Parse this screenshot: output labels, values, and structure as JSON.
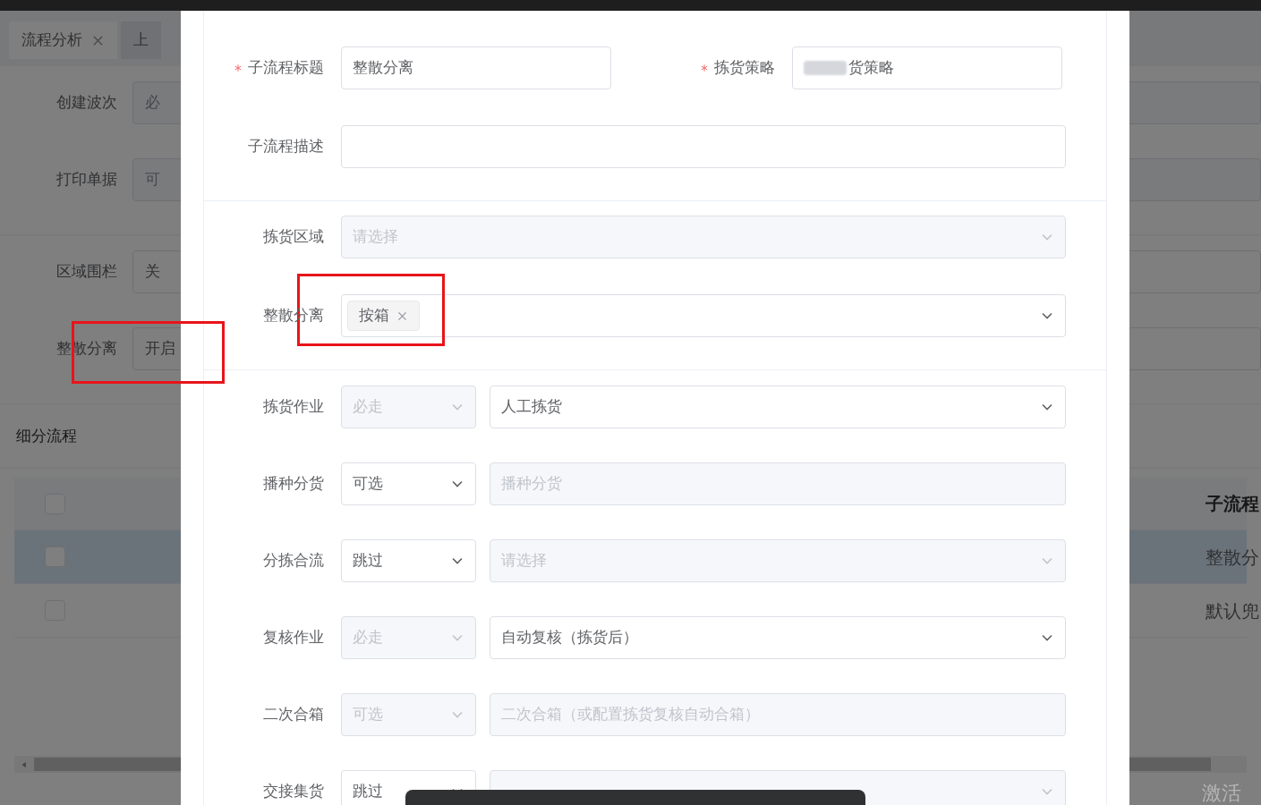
{
  "background": {
    "tabs": [
      {
        "label": "流程分析",
        "closable": true,
        "selected": true
      },
      {
        "label": "上",
        "closable": false,
        "selected": false
      }
    ],
    "form_groups": [
      [
        {
          "label": "创建波次",
          "value": "必",
          "disabled": true
        },
        {
          "label": "打印单据",
          "value": "可",
          "disabled": true
        }
      ],
      [
        {
          "label": "区域围栏",
          "value": "关",
          "disabled": false
        },
        {
          "label": "整散分离",
          "value": "开启",
          "disabled": false
        }
      ]
    ],
    "section_title": "细分流程",
    "table": {
      "column_header": "子流程",
      "header_checked": false,
      "rows": [
        {
          "cell": "整散分",
          "selected": true,
          "checked": false
        },
        {
          "cell": "默认兜",
          "selected": false,
          "checked": false
        }
      ]
    },
    "system_notice": "激活"
  },
  "dialog": {
    "header_fields": [
      {
        "label": "子流程标题",
        "required": true,
        "value": "整散分离",
        "redacted": false
      },
      {
        "label": "拣货策略",
        "required": true,
        "value": "货策略",
        "redacted": true
      }
    ],
    "description": {
      "label": "子流程描述"
    },
    "pick_area": {
      "label": "拣货区域",
      "placeholder": "请选择",
      "disabled": true
    },
    "split": {
      "label": "整散分离",
      "tags": [
        "按箱"
      ]
    },
    "steps": [
      {
        "label": "拣货作业",
        "mode": {
          "value": "必走",
          "disabled": true
        },
        "option": {
          "text": "人工拣货",
          "disabled": false,
          "dropdown": true
        }
      },
      {
        "label": "播种分货",
        "mode": {
          "value": "可选",
          "disabled": false
        },
        "option": {
          "text": "播种分货",
          "disabled": true,
          "dropdown": false
        }
      },
      {
        "label": "分拣合流",
        "mode": {
          "value": "跳过",
          "disabled": false
        },
        "option": {
          "text": "请选择",
          "disabled": true,
          "dropdown": true
        }
      },
      {
        "label": "复核作业",
        "mode": {
          "value": "必走",
          "disabled": true
        },
        "option": {
          "text": "自动复核（拣货后）",
          "disabled": false,
          "dropdown": true
        }
      },
      {
        "label": "二次合箱",
        "mode": {
          "value": "可选",
          "disabled": true
        },
        "option": {
          "text": "二次合箱（或配置拣货复核自动合箱）",
          "disabled": true,
          "dropdown": false
        }
      },
      {
        "label": "交接集货",
        "mode": {
          "value": "跳过",
          "disabled": false
        },
        "option": {
          "disabled": true,
          "dropdown": true
        }
      }
    ]
  }
}
